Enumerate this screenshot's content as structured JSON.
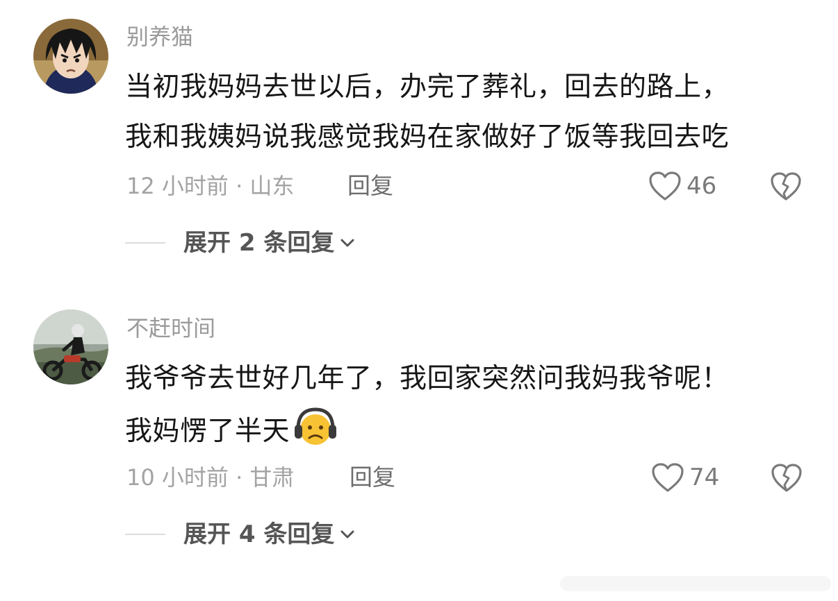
{
  "comments": [
    {
      "username": "别养猫",
      "lines": [
        "当初我妈妈去世以后，办完了葬礼，回去的路上，",
        "我和我姨妈说我感觉我妈在家做好了饭等我回去吃"
      ],
      "meta": "12 小时前 · 山东",
      "reply_label": "回复",
      "likes": "46",
      "expand_label": "展开 2 条回复"
    },
    {
      "username": "不赶时间",
      "lines": [
        "我爷爷去世好几年了，我回家突然问我妈我爷呢！",
        "我妈愣了半天"
      ],
      "meta": "10 小时前 · 甘肃",
      "reply_label": "回复",
      "likes": "74",
      "expand_label": "展开 4 条回复"
    }
  ],
  "icons": {
    "like": "heart-outline-icon",
    "dislike": "broken-heart-icon",
    "expand": "chevron-down-icon",
    "emoji": "headphones-frown-emoji-icon"
  },
  "colors": {
    "text": "#161616",
    "muted": "#a3a3a3",
    "icon": "#7a7a7a"
  }
}
